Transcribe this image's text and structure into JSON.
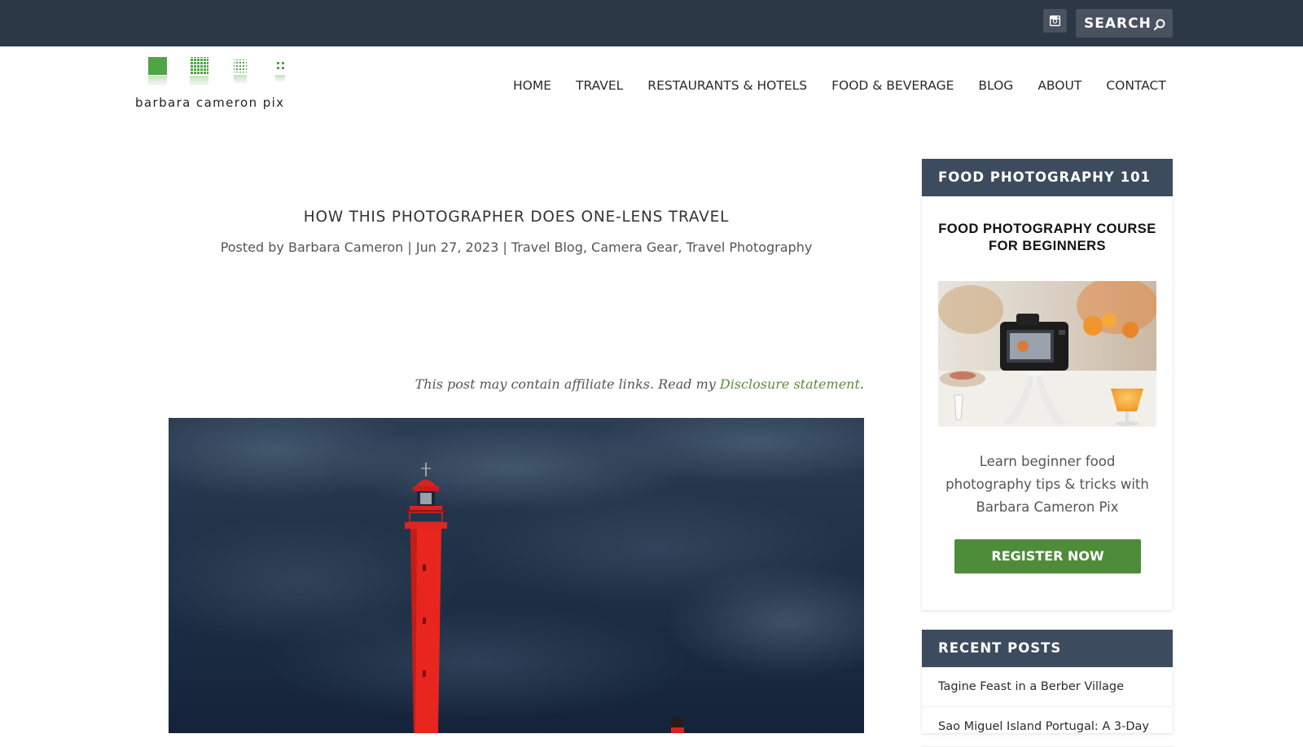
{
  "topbar": {
    "search_placeholder": "SEARCH"
  },
  "logo": {
    "text": "barbara cameron pix"
  },
  "nav": {
    "items": [
      "HOME",
      "TRAVEL",
      "RESTAURANTS & HOTELS",
      "FOOD & BEVERAGE",
      "BLOG",
      "ABOUT",
      "CONTACT"
    ]
  },
  "post": {
    "title": "HOW THIS PHOTOGRAPHER DOES ONE-LENS TRAVEL",
    "meta_prefix": "Posted by",
    "author": "Barbara Cameron",
    "separator": "|",
    "date": "Jun 27, 2023",
    "categories": [
      "Travel Blog",
      "Camera Gear",
      "Travel Photography"
    ],
    "affiliate_text": "This post may contain affiliate links. Read my ",
    "affiliate_link": "Disclosure statement",
    "affiliate_end": "."
  },
  "sidebar": {
    "course_widget": {
      "heading": "FOOD PHOTOGRAPHY 101",
      "title_line1": "FOOD PHOTOGRAPHY COURSE",
      "title_line2": "FOR BEGINNERS",
      "description": "Learn beginner food photography tips & tricks with Barbara Cameron Pix",
      "button_label": "REGISTER NOW"
    },
    "recent_posts": {
      "heading": "RECENT POSTS",
      "items": [
        "Tagine Feast in a Berber Village",
        "Sao Miguel Island Portugal: A 3-Day"
      ]
    }
  },
  "colors": {
    "topbar": "#2c3846",
    "widget_header": "#3c4b5e",
    "accent_green": "#4f8c3a",
    "link_green": "#5b8c3a"
  }
}
